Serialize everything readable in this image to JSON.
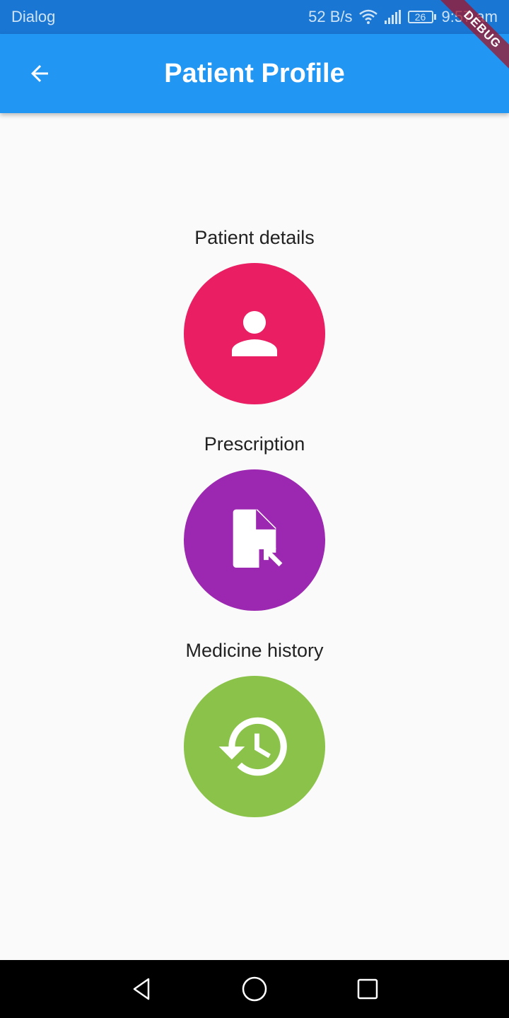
{
  "status_bar": {
    "carrier": "Dialog",
    "network_speed": "52 B/s",
    "battery_level": "26",
    "time": "9:57 am",
    "icons": [
      "wifi-icon",
      "signal-icon",
      "battery-icon"
    ]
  },
  "app_bar": {
    "title": "Patient Profile",
    "back_icon": "arrow-back-icon",
    "debug_banner": "DEBUG"
  },
  "items": [
    {
      "label": "Patient details",
      "icon": "person-icon",
      "color": "#e91e63"
    },
    {
      "label": "Prescription",
      "icon": "file-download-icon",
      "color": "#9c27b0"
    },
    {
      "label": "Medicine history",
      "icon": "history-icon",
      "color": "#8bc34a"
    }
  ],
  "nav_bar": {
    "icons": [
      "back-triangle-icon",
      "home-circle-icon",
      "recents-square-icon"
    ]
  },
  "colors": {
    "status_bar": "#1976d2",
    "app_bar": "#2196f3",
    "background": "#fafafa"
  }
}
